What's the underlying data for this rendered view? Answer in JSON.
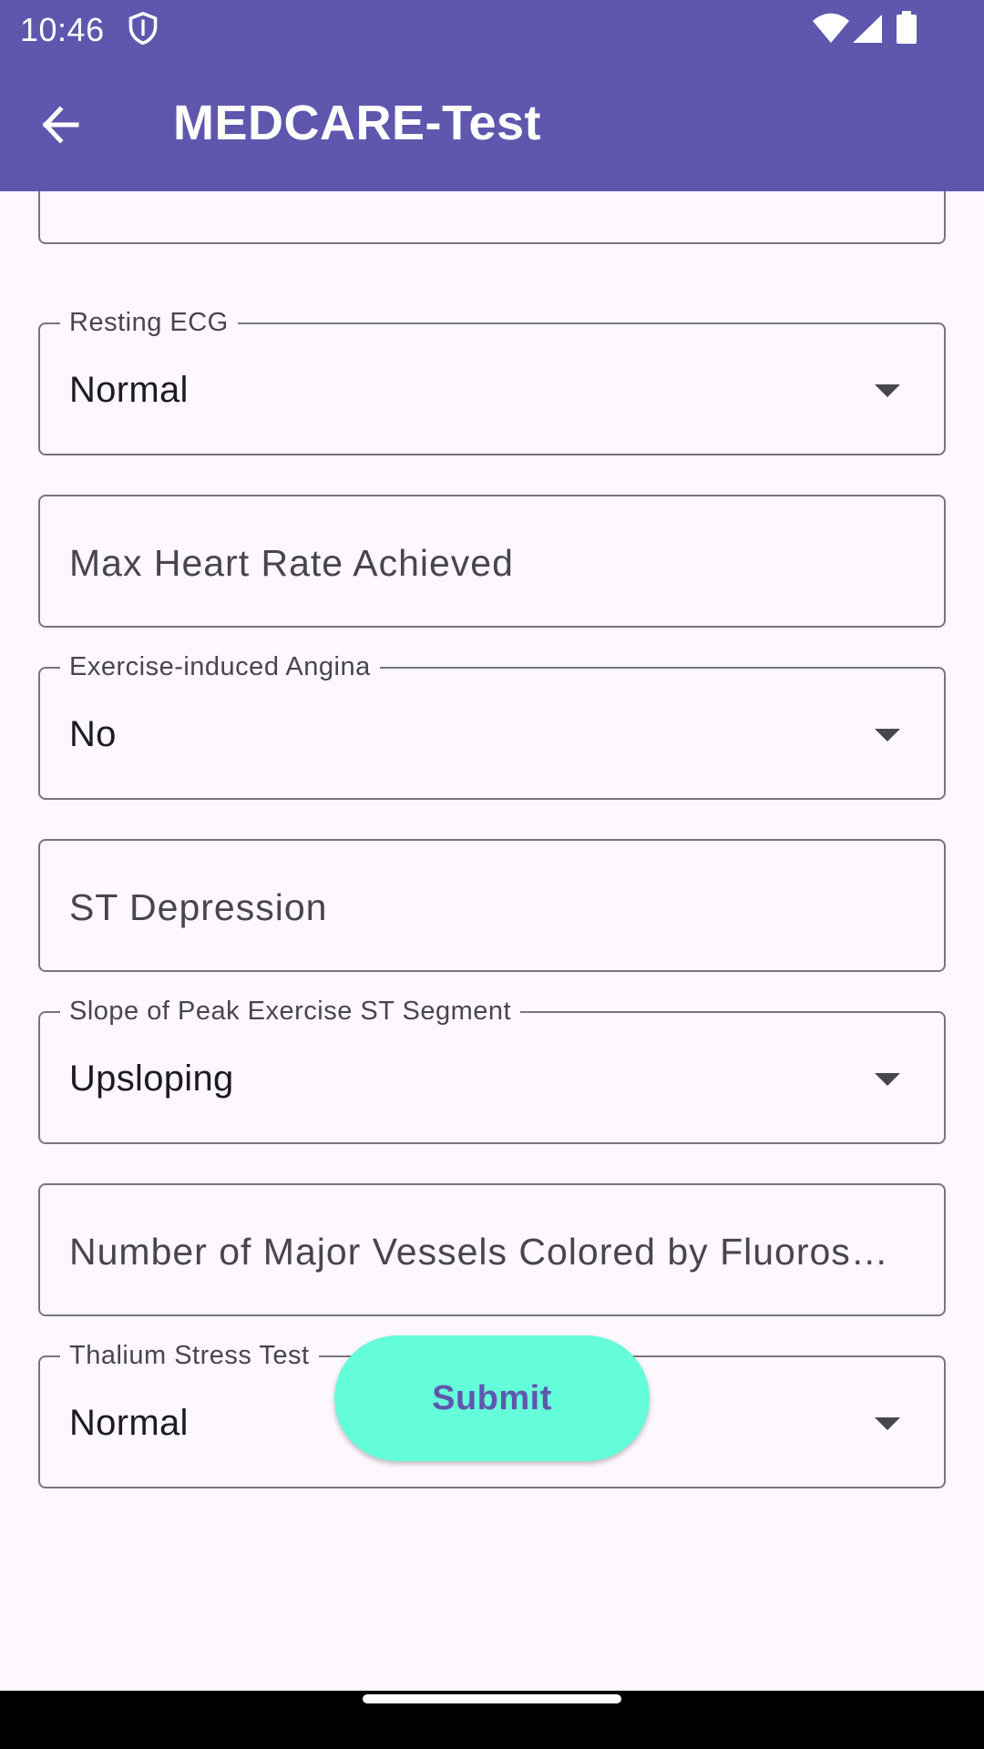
{
  "status_bar": {
    "time": "10:46",
    "icons": [
      "shield-icon",
      "wifi-icon",
      "signal-icon",
      "battery-icon"
    ]
  },
  "app_bar": {
    "title": "MEDCARE-Test",
    "back_icon": "arrow-back-icon"
  },
  "form": {
    "resting_ecg": {
      "label": "Resting ECG",
      "value": "Normal"
    },
    "max_heart_rate": {
      "placeholder": "Max Heart Rate Achieved"
    },
    "exercise_angina": {
      "label": "Exercise-induced Angina",
      "value": "No"
    },
    "st_depression": {
      "placeholder": "ST Depression"
    },
    "slope": {
      "label": "Slope of Peak Exercise ST Segment",
      "value": "Upsloping"
    },
    "major_vessels": {
      "placeholder": "Number of Major Vessels Colored by Fluoroscopy"
    },
    "thalium": {
      "label": "Thalium Stress Test",
      "value": "Normal"
    },
    "submit_label": "Submit"
  },
  "colors": {
    "primary": "#5f57ae",
    "accent": "#64ffda",
    "background": "#fdf7fe",
    "outline": "#79747e"
  }
}
